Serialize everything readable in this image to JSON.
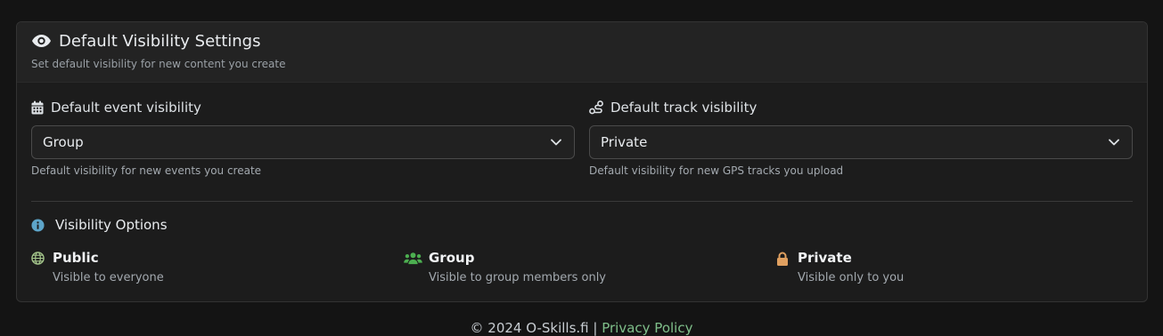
{
  "header": {
    "title": "Default Visibility Settings",
    "subtitle": "Set default visibility for new content you create"
  },
  "event_visibility": {
    "label": "Default event visibility",
    "value": "Group",
    "help": "Default visibility for new events you create"
  },
  "track_visibility": {
    "label": "Default track visibility",
    "value": "Private",
    "help": "Default visibility for new GPS tracks you upload"
  },
  "options": {
    "title": "Visibility Options",
    "public": {
      "name": "Public",
      "desc": "Visible to everyone"
    },
    "group": {
      "name": "Group",
      "desc": "Visible to group members only"
    },
    "private": {
      "name": "Private",
      "desc": "Visible only to you"
    }
  },
  "footer": {
    "copyright": "© 2024 O-Skills.fi",
    "separator": "|",
    "privacy_link": "Privacy Policy"
  },
  "colors": {
    "public_icon": "#a3c48a",
    "group_icon": "#4caf50",
    "private_icon": "#e0a060",
    "info_icon": "#5da5c9",
    "link": "#7fbf8a"
  },
  "icons": {
    "header": "eye-icon",
    "event": "calendar-icon",
    "track": "route-icon",
    "info": "info-circle-icon",
    "public": "globe-icon",
    "group": "users-icon",
    "private": "lock-icon",
    "select": "chevron-down-icon"
  }
}
